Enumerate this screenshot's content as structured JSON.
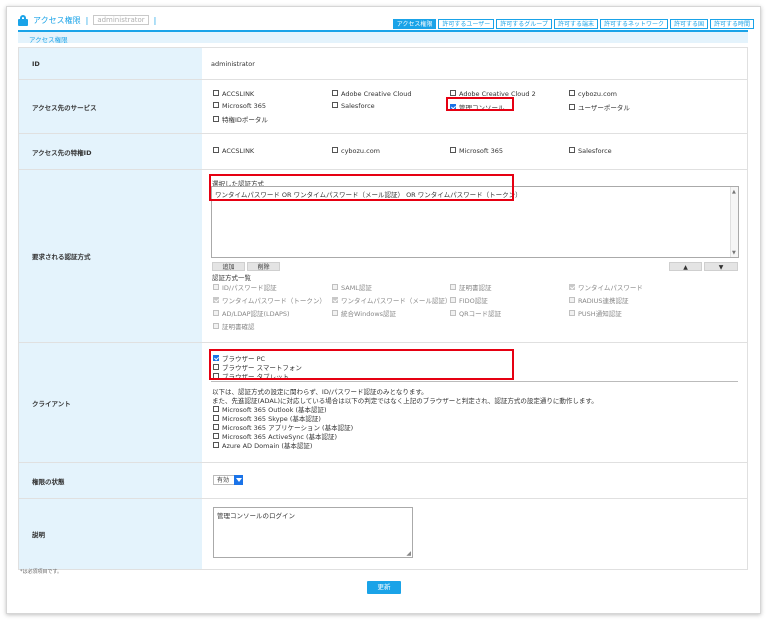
{
  "header": {
    "title": "アクセス権限",
    "separator": "|",
    "username": "administrator",
    "separator2": "|"
  },
  "tabs": [
    {
      "label": "アクセス権限",
      "active": true
    },
    {
      "label": "許可するユーザー",
      "active": false
    },
    {
      "label": "許可するグループ",
      "active": false
    },
    {
      "label": "許可する端末",
      "active": false
    },
    {
      "label": "許可するネットワーク",
      "active": false
    },
    {
      "label": "許可する国",
      "active": false
    },
    {
      "label": "許可する時間",
      "active": false
    }
  ],
  "section_title": "アクセス権限",
  "form": {
    "id": {
      "label": "ID",
      "value": "administrator"
    },
    "services": {
      "label": "アクセス先のサービス",
      "options": [
        {
          "label": "ACCSLINK",
          "checked": false
        },
        {
          "label": "Adobe Creative Cloud",
          "checked": false
        },
        {
          "label": "Adobe Creative Cloud 2",
          "checked": false
        },
        {
          "label": "cybozu.com",
          "checked": false
        },
        {
          "label": "Microsoft 365",
          "checked": false
        },
        {
          "label": "Salesforce",
          "checked": false
        },
        {
          "label": "管理コンソール",
          "checked": true
        },
        {
          "label": "ユーザーポータル",
          "checked": false
        },
        {
          "label": "特権IDポータル",
          "checked": false
        }
      ]
    },
    "privileged": {
      "label": "アクセス先の特権ID",
      "options": [
        {
          "label": "ACCSLINK",
          "checked": false
        },
        {
          "label": "cybozu.com",
          "checked": false
        },
        {
          "label": "Microsoft 365",
          "checked": false
        },
        {
          "label": "Salesforce",
          "checked": false
        }
      ]
    },
    "auth": {
      "label": "要求される認証方式",
      "selected_title": "選択した認証方式",
      "selected_value": "ワンタイムパスワード OR ワンタイムパスワード（メール認証） OR ワンタイムパスワード（トークン）",
      "add_label": "追加",
      "delete_label": "削除",
      "up_label": "▲",
      "down_label": "▼",
      "list_title": "認証方式一覧",
      "methods": [
        {
          "label": "ID/パスワード認証",
          "checked": false
        },
        {
          "label": "SAML認証",
          "checked": false
        },
        {
          "label": "証明書認証",
          "checked": false
        },
        {
          "label": "ワンタイムパスワード",
          "checked": true
        },
        {
          "label": "ワンタイムパスワード（トークン）",
          "checked": true
        },
        {
          "label": "ワンタイムパスワード（メール認証）",
          "checked": true
        },
        {
          "label": "FIDO認証",
          "checked": false
        },
        {
          "label": "RADIUS連携認証",
          "checked": false
        },
        {
          "label": "AD/LDAP認証(LDAPS)",
          "checked": false
        },
        {
          "label": "統合Windows認証",
          "checked": false
        },
        {
          "label": "QRコード認証",
          "checked": false
        },
        {
          "label": "PUSH通知認証",
          "checked": false
        },
        {
          "label": "証明書確認",
          "checked": false
        }
      ]
    },
    "client": {
      "label": "クライアント",
      "browsers": [
        {
          "label": "ブラウザー PC",
          "checked": true
        },
        {
          "label": "ブラウザー スマートフォン",
          "checked": false
        },
        {
          "label": "ブラウザー タブレット",
          "checked": false
        }
      ],
      "note1": "以下は、認証方式の設定に関わらず、ID/パスワード認証のみとなります。",
      "note2": "また、先進認証(ADAL)に対応している場合は以下の判定ではなく上記のブラウザーと判定され、認証方式の設定通りに動作します。",
      "legacy": [
        {
          "label": "Microsoft 365 Outlook (基本認証)",
          "checked": false
        },
        {
          "label": "Microsoft 365 Skype (基本認証)",
          "checked": false
        },
        {
          "label": "Microsoft 365 アプリケーション (基本認証)",
          "checked": false
        },
        {
          "label": "Microsoft 365 ActiveSync (基本認証)",
          "checked": false
        },
        {
          "label": "Azure AD Domain (基本認証)",
          "checked": false
        }
      ]
    },
    "status": {
      "label": "権限の状態",
      "value": "有効"
    },
    "description": {
      "label": "説明",
      "value": "管理コンソールのログイン"
    }
  },
  "footer_note": "*は必須項目です。",
  "submit_label": "更新",
  "colors": {
    "accent": "#1aa3e8",
    "label_bg": "#e4f3fc",
    "highlight": "#e60012"
  }
}
